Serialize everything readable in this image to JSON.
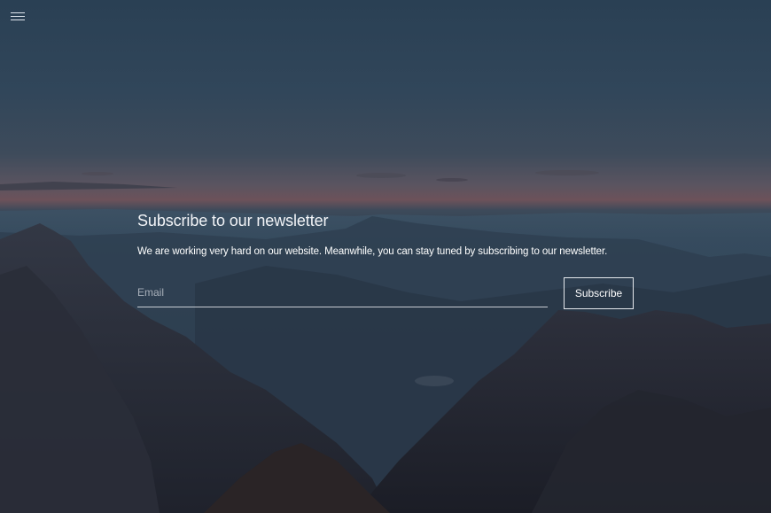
{
  "header": {
    "menu_icon": "hamburger-menu-icon"
  },
  "newsletter": {
    "heading": "Subscribe to our newsletter",
    "description": "We are working very hard on our website. Meanwhile, you can stay tuned by subscribing to our newsletter.",
    "email_placeholder": "Email",
    "email_value": "",
    "subscribe_label": "Subscribe"
  },
  "colors": {
    "sky_top": "#2b4257",
    "horizon_glow": "#6d5058",
    "mountains": "#262a36",
    "overlay_text": "#ffffff"
  }
}
